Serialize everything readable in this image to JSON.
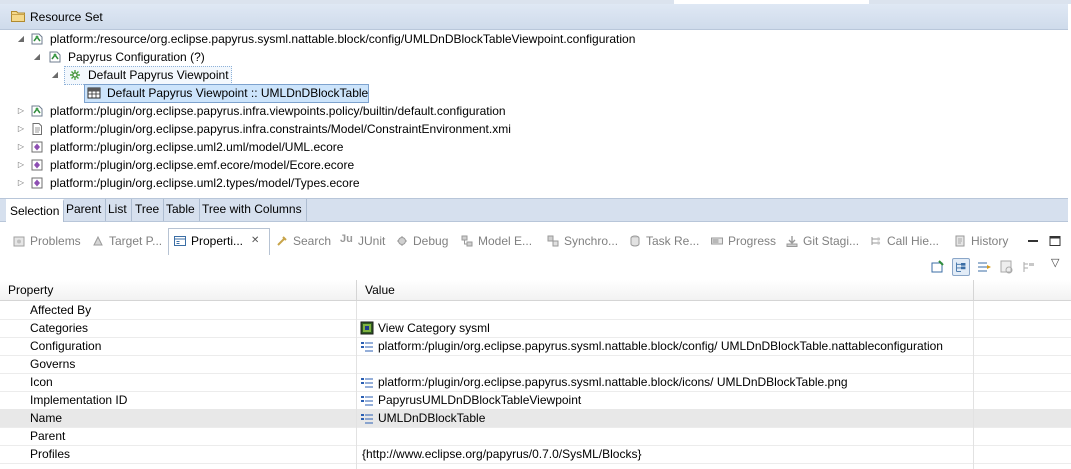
{
  "resource_set": {
    "title": "Resource Set",
    "tree": [
      {
        "label": "platform:/resource/org.eclipse.papyrus.sysml.nattable.block/config/UMLDnDBlockTableViewpoint.configuration",
        "icon": "configuration-icon",
        "expanded": true
      },
      {
        "label": "Papyrus Configuration (?)",
        "icon": "configuration-icon",
        "expanded": true
      },
      {
        "label": "Default Papyrus Viewpoint",
        "icon": "viewpoint-icon",
        "expanded": true
      },
      {
        "label": "Default Papyrus Viewpoint :: UMLDnDBlockTable",
        "icon": "table-icon"
      },
      {
        "label": "platform:/plugin/org.eclipse.papyrus.infra.viewpoints.policy/builtin/default.configuration",
        "icon": "configuration-icon",
        "expanded": false
      },
      {
        "label": "platform:/plugin/org.eclipse.papyrus.infra.constraints/Model/ConstraintEnvironment.xmi",
        "icon": "file-icon",
        "expanded": false
      },
      {
        "label": "platform:/plugin/org.eclipse.uml2.uml/model/UML.ecore",
        "icon": "ecore-icon",
        "expanded": false
      },
      {
        "label": "platform:/plugin/org.eclipse.emf.ecore/model/Ecore.ecore",
        "icon": "ecore-icon",
        "expanded": false
      },
      {
        "label": "platform:/plugin/org.eclipse.uml2.types/model/Types.ecore",
        "icon": "ecore-icon",
        "expanded": false
      }
    ],
    "bottom_tabs": [
      "Selection",
      "Parent",
      "List",
      "Tree",
      "Table",
      "Tree with Columns"
    ],
    "active_bottom_tab": "Selection"
  },
  "views": {
    "tabs": [
      {
        "label": "Problems",
        "icon": "problems-icon"
      },
      {
        "label": "Target P...",
        "icon": "target-icon"
      },
      {
        "label": "Properti...",
        "icon": "properties-icon",
        "active": true
      },
      {
        "label": "Search",
        "icon": "search-icon"
      },
      {
        "label": "JUnit",
        "icon": "junit-icon"
      },
      {
        "label": "Debug",
        "icon": "debug-icon"
      },
      {
        "label": "Model E...",
        "icon": "model-explorer-icon"
      },
      {
        "label": "Synchro...",
        "icon": "synchronize-icon"
      },
      {
        "label": "Task Re...",
        "icon": "task-repository-icon"
      },
      {
        "label": "Progress",
        "icon": "progress-icon"
      },
      {
        "label": "Git Stagi...",
        "icon": "git-staging-icon"
      },
      {
        "label": "Call Hie...",
        "icon": "call-hierarchy-icon"
      },
      {
        "label": "History",
        "icon": "history-icon"
      }
    ],
    "close_glyph": "✕"
  },
  "properties": {
    "columns": [
      "Property",
      "Value"
    ],
    "rows": [
      {
        "name": "Affected By",
        "value": ""
      },
      {
        "name": "Categories",
        "value": "View Category sysml",
        "icon": "category-icon"
      },
      {
        "name": "Configuration",
        "value": "platform:/plugin/org.eclipse.papyrus.sysml.nattable.block/config/ UMLDnDBlockTable.nattableconfiguration",
        "icon": "attribute-icon"
      },
      {
        "name": "Governs",
        "value": ""
      },
      {
        "name": "Icon",
        "value": "platform:/plugin/org.eclipse.papyrus.sysml.nattable.block/icons/ UMLDnDBlockTable.png",
        "icon": "attribute-icon"
      },
      {
        "name": "Implementation ID",
        "value": "PapyrusUMLDnDBlockTableViewpoint",
        "icon": "attribute-icon"
      },
      {
        "name": "Name",
        "value": "UMLDnDBlockTable",
        "icon": "attribute-icon",
        "selected": true
      },
      {
        "name": "Parent",
        "value": ""
      },
      {
        "name": "Profiles",
        "value": "{http://www.eclipse.org/papyrus/0.7.0/SysML/Blocks}"
      }
    ]
  }
}
